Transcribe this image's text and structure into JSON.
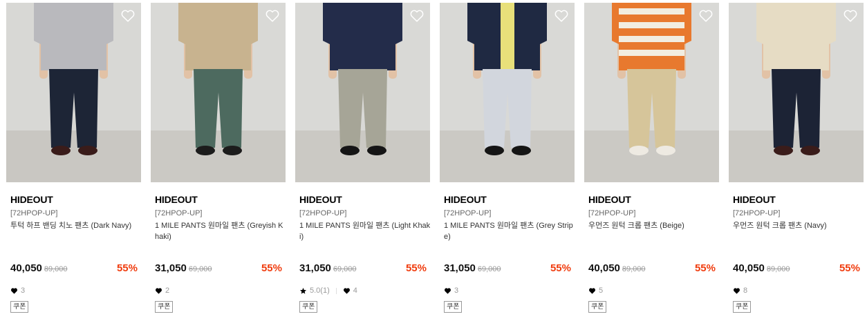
{
  "products": [
    {
      "brand": "HIDEOUT",
      "tag": "[72HPOP-UP]",
      "name": "투턱 하프 밴딩 치노 팬츠 (Dark Navy)",
      "price": "40,050",
      "original_price": "89,000",
      "discount": "55%",
      "rating": null,
      "likes": "3",
      "coupon": "쿠폰",
      "icon": "heart-outline-icon",
      "colors": {
        "top": "#b9b9bd",
        "pants": "#1d2536",
        "shoes": "#3a1c1a",
        "bg": "#d8d8d5",
        "floor": "#c9c7c2"
      }
    },
    {
      "brand": "HIDEOUT",
      "tag": "[72HPOP-UP]",
      "name": "1 MILE PANTS 원마일 팬츠 (Greyish Khaki)",
      "price": "31,050",
      "original_price": "69,000",
      "discount": "55%",
      "rating": null,
      "likes": "2",
      "coupon": "쿠폰",
      "icon": "heart-outline-icon",
      "colors": {
        "top": "#c8b38f",
        "pants": "#4d6a5f",
        "shoes": "#1c1c1c",
        "bg": "#d9d9d6",
        "floor": "#cbc9c4"
      }
    },
    {
      "brand": "HIDEOUT",
      "tag": "[72HPOP-UP]",
      "name": "1 MILE PANTS 원마일 팬츠 (Light Khaki)",
      "price": "31,050",
      "original_price": "69,000",
      "discount": "55%",
      "rating": "5.0(1)",
      "likes": "4",
      "coupon": "쿠폰",
      "icon": "heart-outline-icon",
      "colors": {
        "top": "#232c4a",
        "pants": "#a6a597",
        "shoes": "#151515",
        "bg": "#d9d9d6",
        "floor": "#cbc9c4"
      }
    },
    {
      "brand": "HIDEOUT",
      "tag": "[72HPOP-UP]",
      "name": "1 MILE PANTS 원마일 팬츠 (Grey Stripe)",
      "price": "31,050",
      "original_price": "69,000",
      "discount": "55%",
      "rating": null,
      "likes": "3",
      "coupon": "쿠폰",
      "icon": "heart-outline-icon",
      "colors": {
        "top": "#1f2942",
        "pants": "#d2d6dd",
        "shoes": "#151515",
        "bg": "#d9d9d6",
        "floor": "#cbc9c4"
      }
    },
    {
      "brand": "HIDEOUT",
      "tag": "[72HPOP-UP]",
      "name": "우먼즈 원턱 크롭 팬츠 (Beige)",
      "price": "40,050",
      "original_price": "89,000",
      "discount": "55%",
      "rating": null,
      "likes": "5",
      "coupon": "쿠폰",
      "icon": "heart-outline-icon",
      "colors": {
        "top": "#e8792e",
        "pants": "#d6c59a",
        "shoes": "#eeeae2",
        "bg": "#d9d9d6",
        "floor": "#cbc9c4"
      }
    },
    {
      "brand": "HIDEOUT",
      "tag": "[72HPOP-UP]",
      "name": "우먼즈 원턱 크롭 팬츠 (Navy)",
      "price": "40,050",
      "original_price": "89,000",
      "discount": "55%",
      "rating": null,
      "likes": "8",
      "coupon": "쿠폰",
      "icon": "heart-outline-icon",
      "colors": {
        "top": "#e6dcc4",
        "pants": "#1c2335",
        "shoes": "#3a1c1a",
        "bg": "#d9d9d6",
        "floor": "#cbc9c4"
      }
    }
  ],
  "colors": {
    "discount": "#f03c0e",
    "muted": "#999999"
  }
}
